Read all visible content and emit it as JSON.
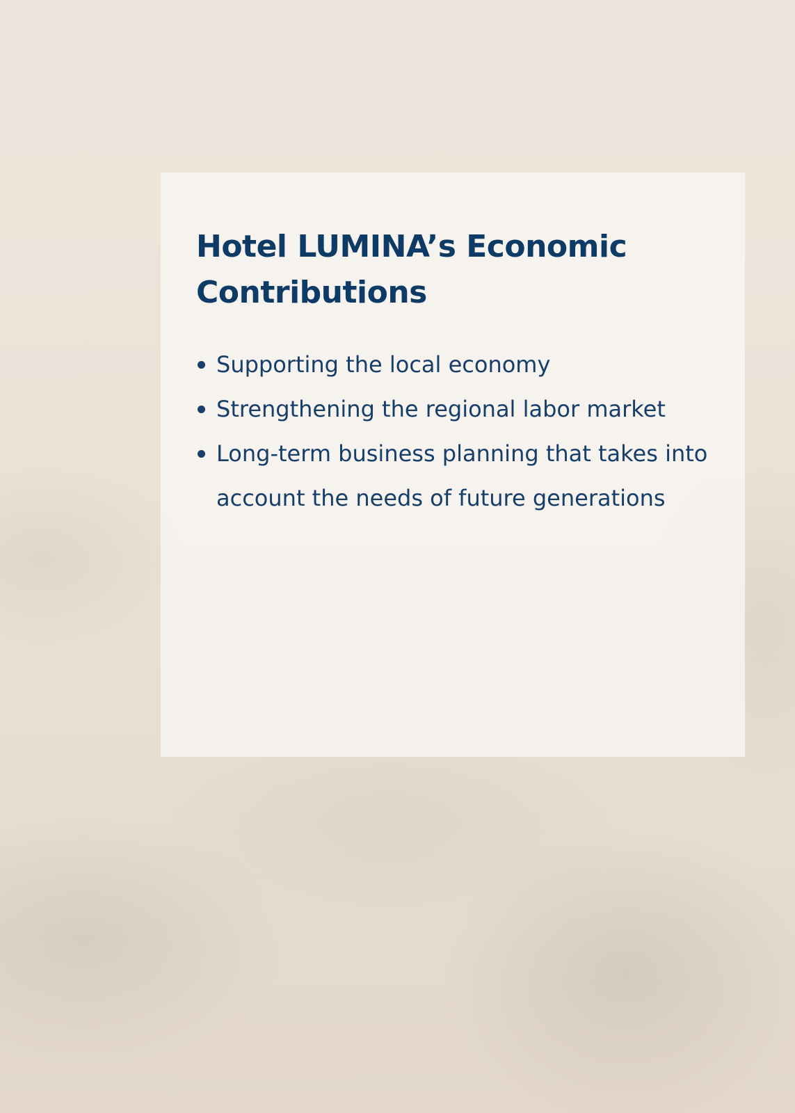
{
  "page": {
    "title": "Hotel LUMINA’s Economic Contributions",
    "bullets": [
      "Supporting the local economy",
      "Strengthening the regional labor market",
      "Long-term business planning that takes into account the needs of future generations"
    ]
  },
  "colors": {
    "title": "#0e3a66",
    "text": "#163e69",
    "card": "#f8f5f2",
    "background": "#ece2d8"
  }
}
